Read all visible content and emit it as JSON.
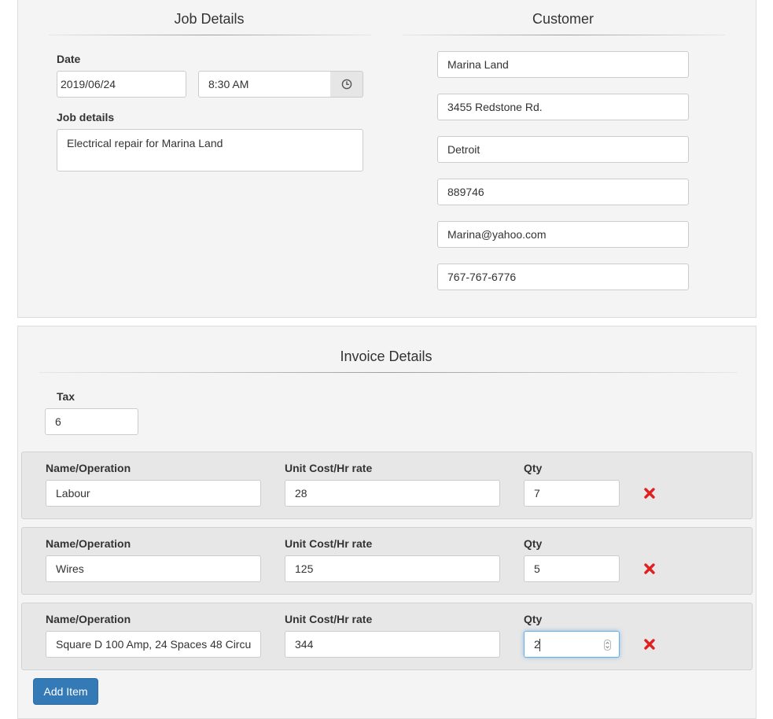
{
  "job": {
    "title": "Job Details",
    "date_label": "Date",
    "date_value": "2019/06/24",
    "time_value": "8:30 AM",
    "details_label": "Job details",
    "details_value": "Electrical repair for Marina Land"
  },
  "customer": {
    "title": "Customer",
    "name": "Marina Land",
    "address": "3455 Redstone Rd.",
    "city": "Detroit",
    "zip": "889746",
    "email": "Marina@yahoo.com",
    "phone": "767-767-6776"
  },
  "invoice": {
    "title": "Invoice Details",
    "tax_label": "Tax",
    "tax_value": "6",
    "columns": {
      "name": "Name/Operation",
      "cost": "Unit Cost/Hr rate",
      "qty": "Qty"
    },
    "items": [
      {
        "name": "Labour",
        "cost": "28",
        "qty": "7"
      },
      {
        "name": "Wires",
        "cost": "125",
        "qty": "5"
      },
      {
        "name": "Square D 100 Amp, 24 Spaces 48 Circu",
        "cost": "344",
        "qty": "2"
      }
    ],
    "add_item_label": "Add Item"
  },
  "colors": {
    "panel_bg": "#f4f4f4",
    "row_bg": "#e7e7e7",
    "primary_button": "#337ab7",
    "remove_icon": "#e02020",
    "focus_ring": "#66afe9"
  },
  "icons": {
    "time": "clock-icon",
    "remove": "remove-x-icon",
    "stepper": "number-stepper-icon"
  }
}
